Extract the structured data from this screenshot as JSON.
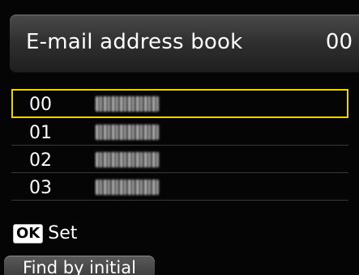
{
  "header": {
    "title": "E-mail address book",
    "count": "00"
  },
  "entries": [
    {
      "number": "00",
      "selected": true
    },
    {
      "number": "01",
      "selected": false
    },
    {
      "number": "02",
      "selected": false
    },
    {
      "number": "03",
      "selected": false
    }
  ],
  "footer": {
    "ok_key": "OK",
    "ok_label": "Set",
    "find_button": "Find by initial"
  },
  "colors": {
    "selection": "#e9d300",
    "background": "#050505"
  }
}
